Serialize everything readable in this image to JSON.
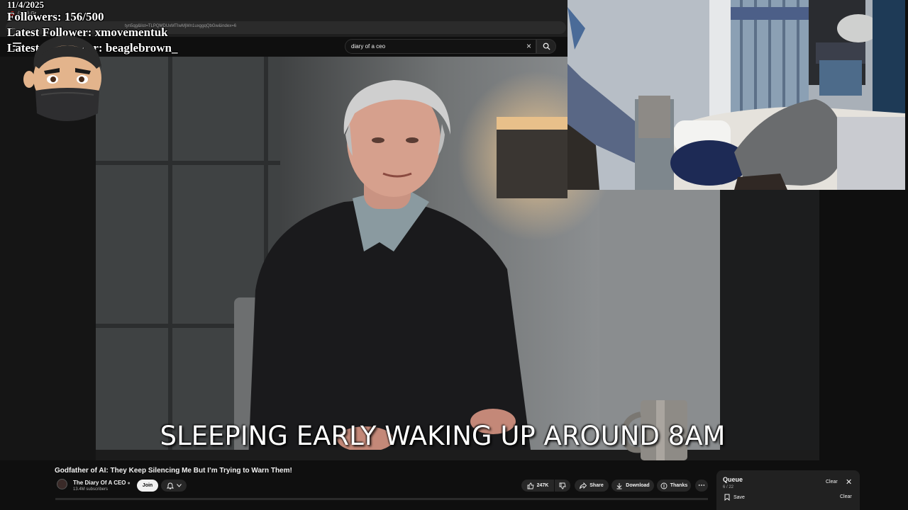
{
  "stream_overlay": {
    "date": "11/4/2025",
    "followers_line": "Followers: 156/500",
    "latest_follower_line": "Latest Follower: xmovementuk",
    "latest_subscriber_line": "Latest Subscriber: beaglebrown_"
  },
  "browser": {
    "tab_label": "(323) Gr",
    "url_fragment": "tyn5qg&list=TLPQMDUxMTIwMjWn1uxggqQbGw&index=6"
  },
  "search": {
    "query": "diary of a ceo"
  },
  "video": {
    "caption": "SLEEPING EARLY WAKING UP AROUND 8AM",
    "title": "Godfather of AI: They Keep Silencing Me But I’m Trying to Warn Them!"
  },
  "channel": {
    "name": "The Diary Of A CEO",
    "subscribers": "13.4M subscribers",
    "join_label": "Join"
  },
  "actions": {
    "likes": "247K",
    "share_label": "Share",
    "download_label": "Download",
    "thanks_label": "Thanks"
  },
  "queue": {
    "title": "Queue",
    "count": "6 / 22",
    "clear_label": "Clear",
    "save_label": "Save",
    "save_clear_label": "Clear"
  },
  "icons": {
    "menu": "menu-icon",
    "search": "search-icon",
    "clear": "close-icon",
    "bell": "bell-icon",
    "like": "thumbs-up-icon",
    "dislike": "thumbs-down-icon",
    "share": "share-icon",
    "download": "download-icon",
    "thanks": "thanks-icon",
    "more": "more-horizontal-icon",
    "save": "bookmark-icon"
  },
  "colors": {
    "page_background": "#0f0f0f",
    "youtube_red": "#e62117",
    "pill_background": "#272727",
    "text_primary": "#f1f1f1",
    "text_secondary": "#aaaaaa"
  }
}
